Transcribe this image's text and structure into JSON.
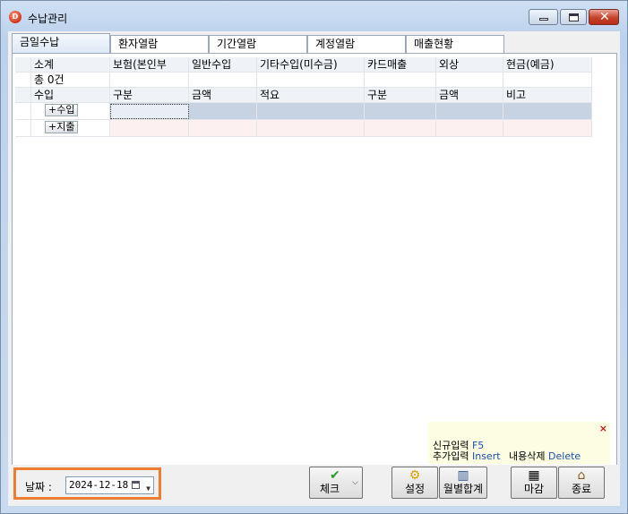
{
  "window": {
    "title": "수납관리",
    "app_icon_letter": "D"
  },
  "tabs": [
    "금일수납",
    "환자열람",
    "기간열람",
    "계정열람",
    "매출현황"
  ],
  "grid": {
    "summary_label": "소계",
    "total_label": "총 0건",
    "summary_headers": [
      "보험(본인부",
      "일반수입",
      "기타수입(미수금)",
      "카드매출",
      "외상",
      "현금(예금)"
    ],
    "entry_label": "수입",
    "entry_headers": [
      "구분",
      "금액",
      "적요",
      "구분",
      "금액",
      "비고"
    ],
    "add_income_button": "+수입",
    "add_expense_button": "+지출"
  },
  "hint": {
    "line1_label": "신규입력",
    "line1_key": "F5",
    "line2_label": "추가입력",
    "line2_key": "Insert",
    "line2_label2": "내용삭제",
    "line2_key2": "Delete",
    "close_mark": "×"
  },
  "bottom": {
    "date_label": "날짜 :",
    "date_value": "2024-12-18",
    "check_button": "체크",
    "settings_button": "설정",
    "monthly_button": "월별합계",
    "close_day_button": "마감",
    "exit_button": "종료"
  },
  "colors": {
    "highlight_border": "#ee7d2f",
    "hint_bg": "#fdfde2",
    "key_text": "#1a4fb0"
  }
}
